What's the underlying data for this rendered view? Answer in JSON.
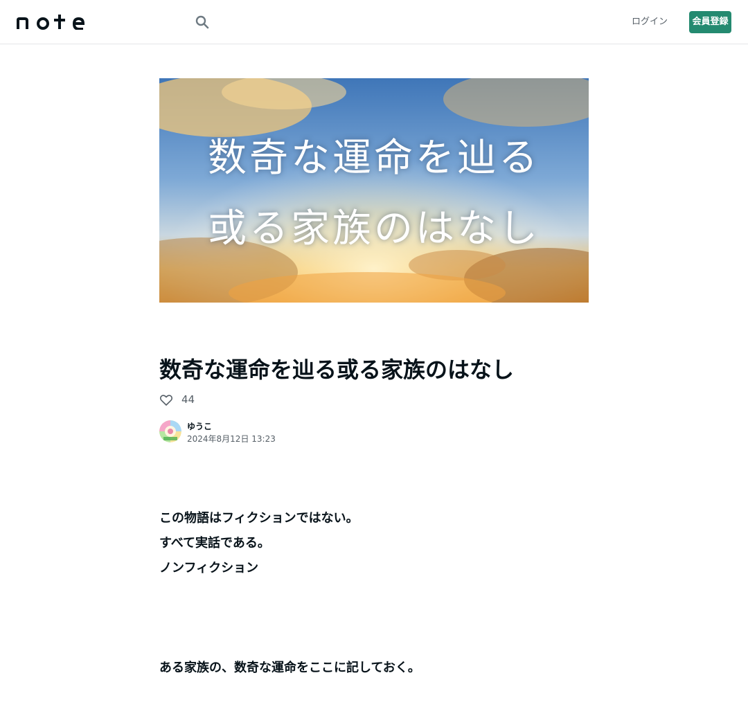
{
  "header": {
    "logo_text": "note",
    "search_icon": "search-icon",
    "login_label": "ログイン",
    "signup_label": "会員登録"
  },
  "hero": {
    "line1": "数奇な運命を辿る",
    "line2": "或る家族のはなし"
  },
  "article": {
    "title": "数奇な運命を辿る或る家族のはなし",
    "like_icon": "heart-icon",
    "like_count": "44",
    "author_name": "ゆうこ",
    "post_date": "2024年8月12日 13:23",
    "paragraphs": [
      "この物語はフィクションではない。",
      "すべて実話である。",
      "ノンフィクション",
      "ある家族の、数奇な運命をここに記しておく。"
    ]
  },
  "colors": {
    "accent": "#248a70",
    "text": "#08131a",
    "muted": "#555e66"
  }
}
